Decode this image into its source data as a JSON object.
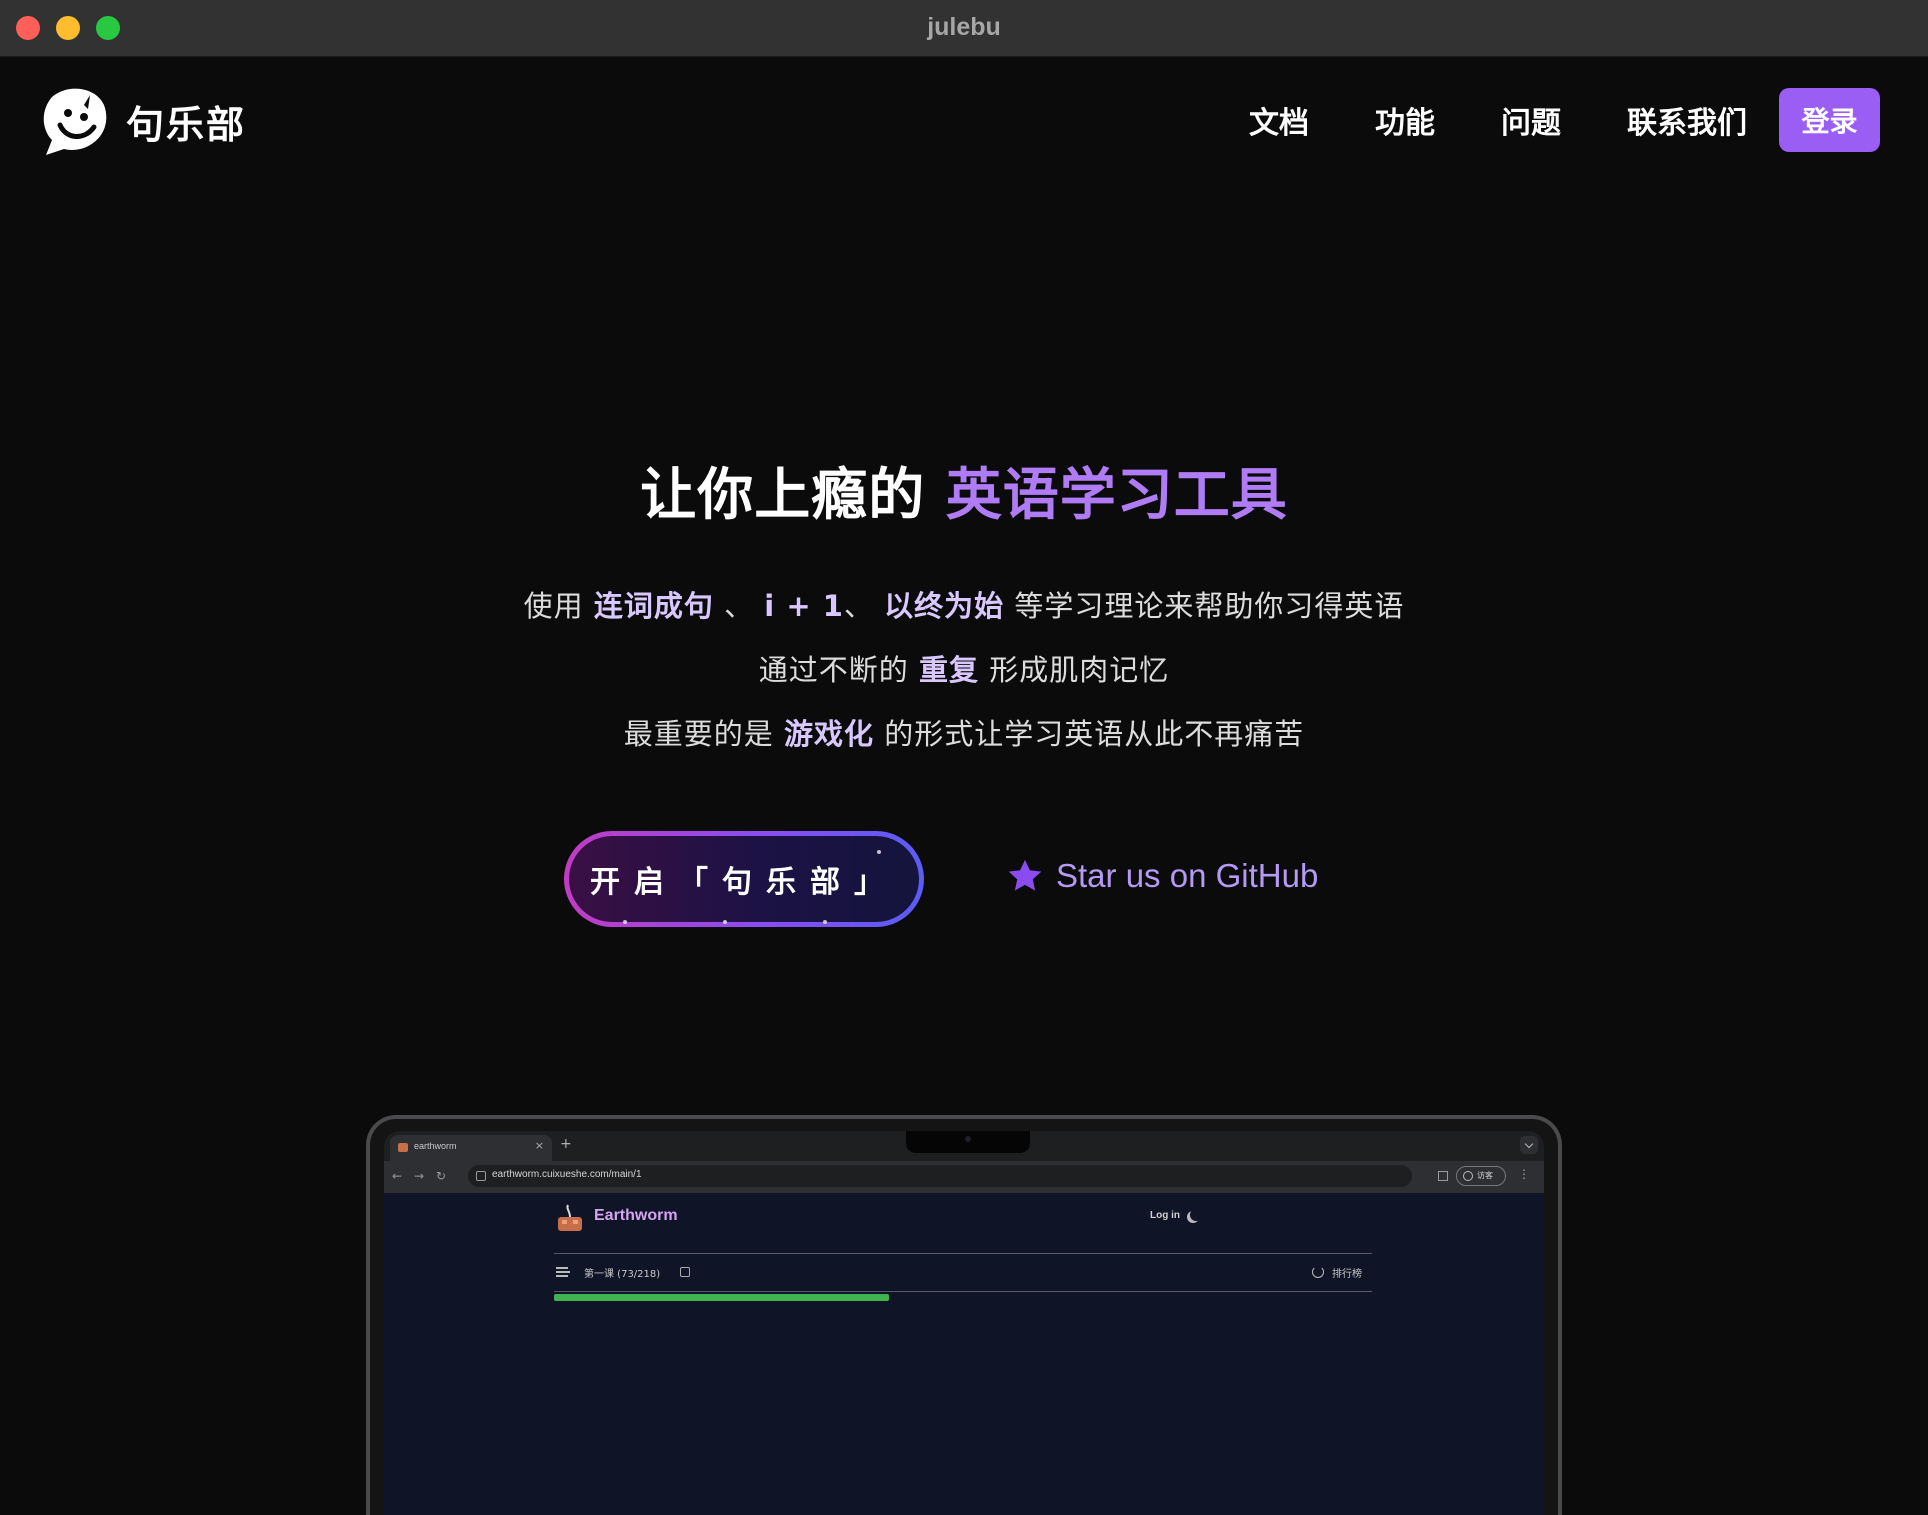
{
  "window": {
    "title": "julebu"
  },
  "header": {
    "brand": "句乐部",
    "nav": [
      "文档",
      "功能",
      "问题",
      "联系我们"
    ],
    "login_label": "登录"
  },
  "hero": {
    "title_plain": "让你上瘾的",
    "title_highlight": "英语学习工具",
    "line1": {
      "prefix": "使用",
      "h1": "连词成句",
      "sep1": "、",
      "h2": "i + 1",
      "sep2": "、",
      "h3": "以终为始",
      "suffix": "等学习理论来帮助你习得英语"
    },
    "line2": {
      "prefix": "通过不断的",
      "h1": "重复",
      "suffix": "形成肌肉记忆"
    },
    "line3": {
      "prefix": "最重要的是",
      "h1": "游戏化",
      "suffix": "的形式让学习英语从此不再痛苦"
    },
    "cta_label": "开启「句乐部」",
    "github_label": "Star us on GitHub"
  },
  "preview": {
    "tab_title": "earthworm",
    "tab_close": "×",
    "new_tab": "+",
    "url": "earthworm.cuixueshe.com/main/1",
    "nav_back": "←",
    "nav_forward": "→",
    "nav_reload": "↻",
    "profile_label": "访客",
    "menu_glyph": "⋮",
    "app_brand": "Earthworm",
    "app_login": "Log in",
    "lesson_label": "第一课 (73/218)",
    "rank_label": "排行榜",
    "progress": 0.41
  },
  "colors": {
    "accent": "#9a5ef5",
    "highlight": "#b07cf5",
    "progress": "#3fb34f"
  },
  "icons": {
    "logo": "speech-bubble-face-icon",
    "github": "star-icon",
    "theme": "moon-icon"
  }
}
